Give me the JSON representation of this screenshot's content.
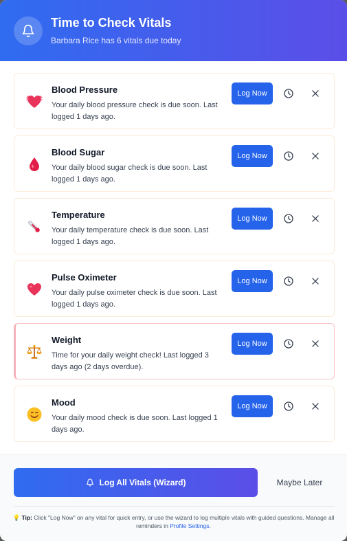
{
  "header": {
    "title": "Time to Check Vitals",
    "subtitle": "Barbara Rice has 6 vitals due today",
    "icon": "bell-icon"
  },
  "vitals": [
    {
      "name": "Blood Pressure",
      "description": "Your daily blood pressure check is due soon. Last logged 1 days ago.",
      "icon": "heart-pulse-icon",
      "log_label": "Log Now",
      "overdue": false
    },
    {
      "name": "Blood Sugar",
      "description": "Your daily blood sugar check is due soon. Last logged 1 days ago.",
      "icon": "blood-drop-icon",
      "log_label": "Log Now",
      "overdue": false
    },
    {
      "name": "Temperature",
      "description": "Your daily temperature check is due soon. Last logged 1 days ago.",
      "icon": "thermometer-icon",
      "log_label": "Log Now",
      "overdue": false
    },
    {
      "name": "Pulse Oximeter",
      "description": "Your daily pulse oximeter check is due soon. Last logged 1 days ago.",
      "icon": "heart-icon",
      "log_label": "Log Now",
      "overdue": false
    },
    {
      "name": "Weight",
      "description": "Time for your daily weight check! Last logged 3 days ago (2 days overdue).",
      "icon": "scale-icon",
      "log_label": "Log Now",
      "overdue": true
    },
    {
      "name": "Mood",
      "description": "Your daily mood check is due soon. Last logged 1 days ago.",
      "icon": "smiley-icon",
      "log_label": "Log Now",
      "overdue": false
    }
  ],
  "footer": {
    "wizard_label": "Log All Vitals (Wizard)",
    "later_label": "Maybe Later",
    "tip_label": "Tip:",
    "tip_text": " Click \"Log Now\" on any vital for quick entry, or use the wizard to log multiple vitals with guided questions. Manage all reminders in ",
    "tip_link": "Profile Settings",
    "tip_end": "."
  },
  "colors": {
    "accent": "#2563eb",
    "gradient_start": "#2f6cf0",
    "gradient_end": "#5b4ee8",
    "card_border": "#fbecd6",
    "overdue_border": "#f7b3bb"
  }
}
